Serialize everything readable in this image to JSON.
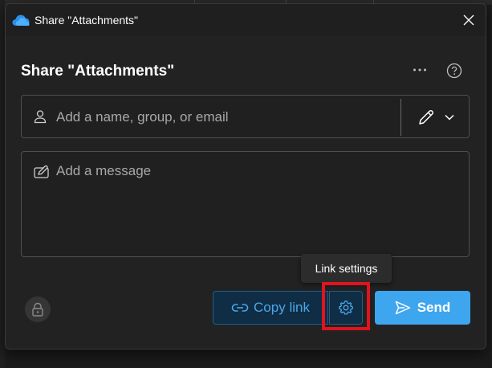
{
  "window": {
    "title": "Share \"Attachments\"",
    "close_icon": "close-icon",
    "app_icon": "onedrive-cloud-icon"
  },
  "dialog": {
    "heading": "Share \"Attachments\"",
    "more_icon": "more-horizontal-icon",
    "help_icon": "help-icon"
  },
  "recipient": {
    "placeholder": "Add a name, group, or email",
    "value": "",
    "permission_icon": "pencil-icon",
    "permission_dropdown_icon": "chevron-down-icon"
  },
  "message": {
    "placeholder": "Add a message",
    "value": ""
  },
  "tooltip": {
    "text": "Link settings"
  },
  "actions": {
    "copy_link_label": "Copy link",
    "send_label": "Send",
    "lock_icon": "lock-icon",
    "link_icon": "link-icon",
    "settings_icon": "gear-icon",
    "send_icon": "send-icon"
  },
  "colors": {
    "accent": "#3ea6ee",
    "copy_link_text": "#4aa6ea",
    "highlight": "#e0141e",
    "background": "#222222"
  }
}
